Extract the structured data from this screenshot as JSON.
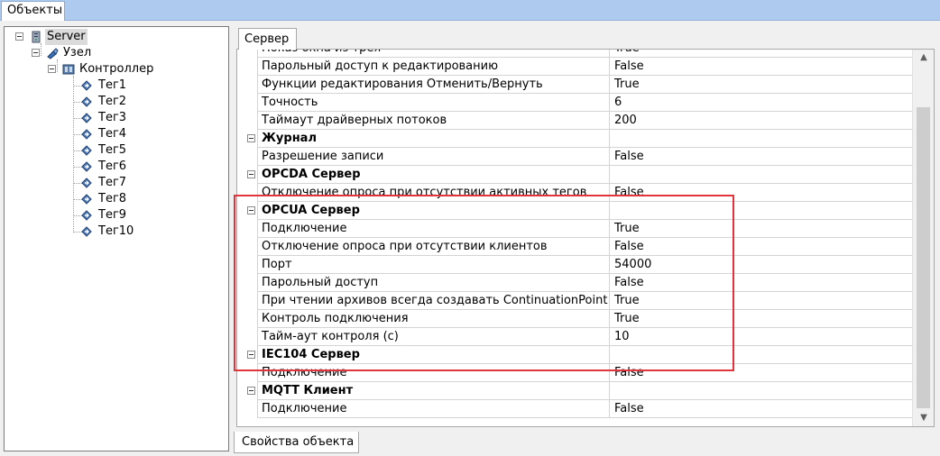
{
  "top_tab": {
    "label": "Объекты"
  },
  "tree": {
    "server": "Server",
    "node": "Узел",
    "controller": "Контроллер",
    "tags": [
      "Тег1",
      "Тег2",
      "Тег3",
      "Тег4",
      "Тег5",
      "Тег6",
      "Тег7",
      "Тег8",
      "Тег9",
      "Тег10"
    ]
  },
  "panel": {
    "tab_label": "Сервер",
    "bottom_tab_label": "Свойства объекта"
  },
  "properties": [
    {
      "type": "prop",
      "name": "Показ окна из трея",
      "value": "True"
    },
    {
      "type": "prop",
      "name": "Парольный доступ к редактированию",
      "value": "False"
    },
    {
      "type": "prop",
      "name": "Функции редактирования Отменить/Вернуть",
      "value": "True"
    },
    {
      "type": "prop",
      "name": "Точность",
      "value": "6"
    },
    {
      "type": "prop",
      "name": "Таймаут драйверных потоков",
      "value": "200"
    },
    {
      "type": "cat",
      "name": "Журнал",
      "value": ""
    },
    {
      "type": "prop",
      "name": "Разрешение записи",
      "value": "False"
    },
    {
      "type": "cat",
      "name": "OPCDA Сервер",
      "value": ""
    },
    {
      "type": "prop",
      "name": "Отключение опроса при отсутствии активных тегов",
      "value": "False"
    },
    {
      "type": "cat",
      "name": "OPCUA Сервер",
      "value": ""
    },
    {
      "type": "prop",
      "name": "Подключение",
      "value": "True"
    },
    {
      "type": "prop",
      "name": "Отключение опроса при отсутствии клиентов",
      "value": "False"
    },
    {
      "type": "prop",
      "name": "Порт",
      "value": "54000"
    },
    {
      "type": "prop",
      "name": "Парольный доступ",
      "value": "False"
    },
    {
      "type": "prop",
      "name": "При чтении архивов всегда создавать ContinuationPoint",
      "value": "True"
    },
    {
      "type": "prop",
      "name": "Контроль подключения",
      "value": "True"
    },
    {
      "type": "prop",
      "name": "Тайм-аут контроля (с)",
      "value": "10"
    },
    {
      "type": "cat",
      "name": "IEC104 Сервер",
      "value": ""
    },
    {
      "type": "prop",
      "name": "Подключение",
      "value": "False"
    },
    {
      "type": "cat",
      "name": "MQTT Клиент",
      "value": ""
    },
    {
      "type": "prop",
      "name": "Подключение",
      "value": "False"
    }
  ],
  "colors": {
    "highlight": "#e2343b",
    "topbar": "#aecbef"
  },
  "icons": {
    "server": "server-icon",
    "node": "node-icon",
    "controller": "controller-icon",
    "tag": "tag-icon",
    "scroll_up": "scroll-up-arrow-icon",
    "scroll_down": "scroll-down-arrow-icon"
  }
}
